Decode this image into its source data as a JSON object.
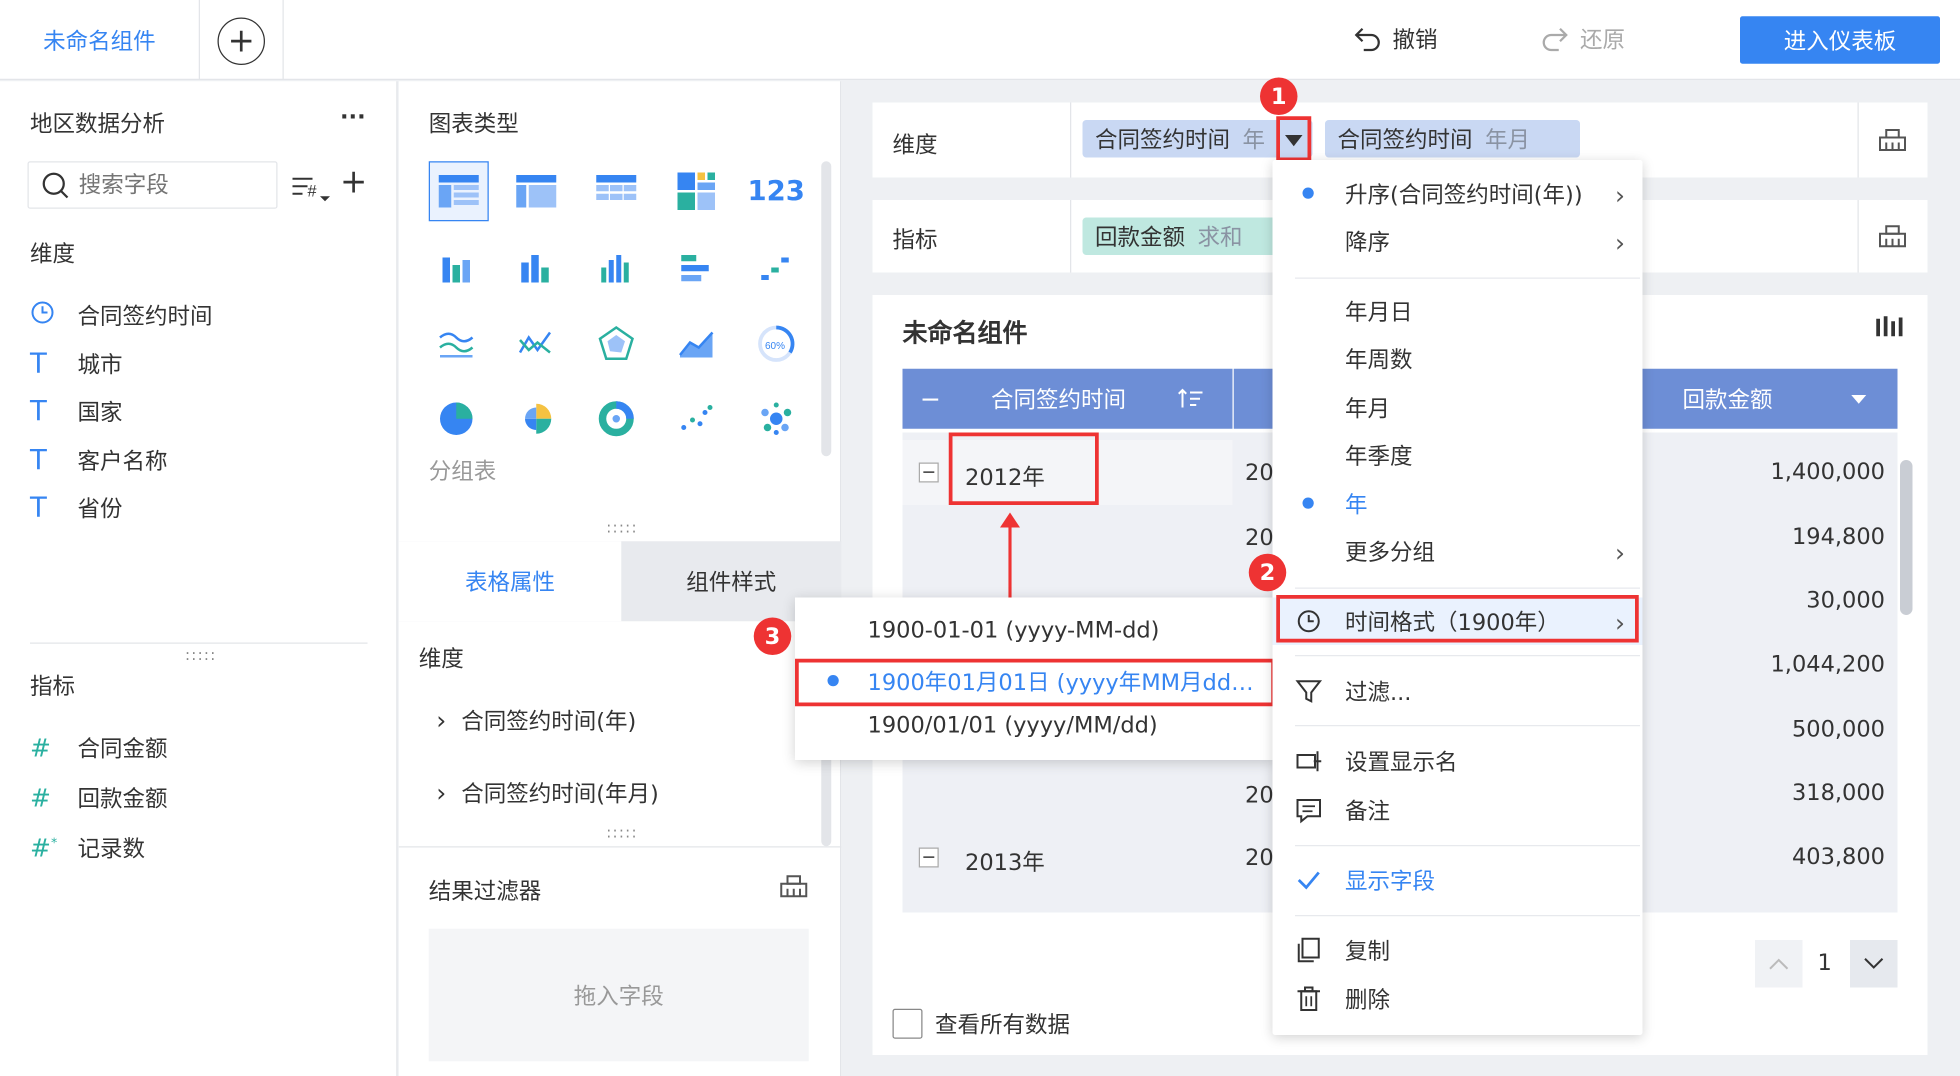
{
  "topbar": {
    "tab_label": "未命名组件",
    "undo_label": "撤销",
    "redo_label": "还原",
    "enter_label": "进入仪表板"
  },
  "left_panel": {
    "dataset_title": "地区数据分析",
    "more": "···",
    "search_placeholder": "搜索字段",
    "dim_title": "维度",
    "dimensions": [
      {
        "label": "合同签约时间",
        "icon": "clock-icon"
      },
      {
        "label": "城市",
        "icon": "text-icon"
      },
      {
        "label": "国家",
        "icon": "text-icon"
      },
      {
        "label": "客户名称",
        "icon": "text-icon"
      },
      {
        "label": "省份",
        "icon": "text-icon"
      }
    ],
    "metric_title": "指标",
    "metrics": [
      {
        "label": "合同金额",
        "icon": "hash-icon"
      },
      {
        "label": "回款金额",
        "icon": "hash-icon"
      },
      {
        "label": "记录数",
        "icon": "hash-star-icon"
      }
    ]
  },
  "mid_panel": {
    "chart_type_title": "图表类型",
    "group_table_label": "分组表",
    "tab_table_attr": "表格属性",
    "tab_comp_style": "组件样式",
    "dim_title": "维度",
    "dim_items": [
      "合同签约时间(年)",
      "合同签约时间(年月)"
    ],
    "filter_title": "结果过滤器",
    "drop_hint": "拖入字段"
  },
  "right": {
    "dim_label": "维度",
    "metric_label": "指标",
    "dim_pill1_name": "合同签约时间",
    "dim_pill1_suffix": "年",
    "dim_pill2_name": "合同签约时间",
    "dim_pill2_suffix": "年月",
    "metric_pill_name": "回款金额",
    "metric_pill_suffix": "求和",
    "component_title": "未命名组件",
    "col1": "合同签约时间",
    "col3": "回款金额",
    "group1": "2012年",
    "group2": "2013年",
    "col2_partial": "20",
    "values": [
      "1,400,000",
      "194,800",
      "30,000",
      "1,044,200",
      "500,000",
      "318,000",
      "403,800"
    ],
    "page_num": "1",
    "view_all": "查看所有数据"
  },
  "menu": {
    "items": [
      {
        "label": "升序(合同签约时间(年))",
        "bullet": true,
        "arrow": true
      },
      {
        "label": "降序",
        "arrow": true
      },
      {
        "label": "年月日"
      },
      {
        "label": "年周数"
      },
      {
        "label": "年月"
      },
      {
        "label": "年季度"
      },
      {
        "label": "年",
        "bullet": true,
        "active": true
      },
      {
        "label": "更多分组",
        "arrow": true
      },
      {
        "label": "时间格式（1900年）",
        "arrow": true,
        "icon": "clock-icon"
      },
      {
        "label": "过滤...",
        "icon": "filter-icon"
      },
      {
        "label": "设置显示名",
        "icon": "rename-icon"
      },
      {
        "label": "备注",
        "icon": "comment-icon"
      },
      {
        "label": "显示字段",
        "icon": "check-icon",
        "active": true
      },
      {
        "label": "复制",
        "icon": "copy-icon"
      },
      {
        "label": "删除",
        "icon": "trash-icon"
      }
    ]
  },
  "submenu": {
    "items": [
      "1900-01-01 (yyyy-MM-dd)",
      "1900年01月01日 (yyyy年MM月dd…",
      "1900/01/01 (yyyy/MM/dd)"
    ]
  },
  "badges": [
    "1",
    "2",
    "3"
  ],
  "colors": {
    "accent": "#3685f2",
    "header": "#6d8ed6",
    "callout": "#e33333"
  }
}
